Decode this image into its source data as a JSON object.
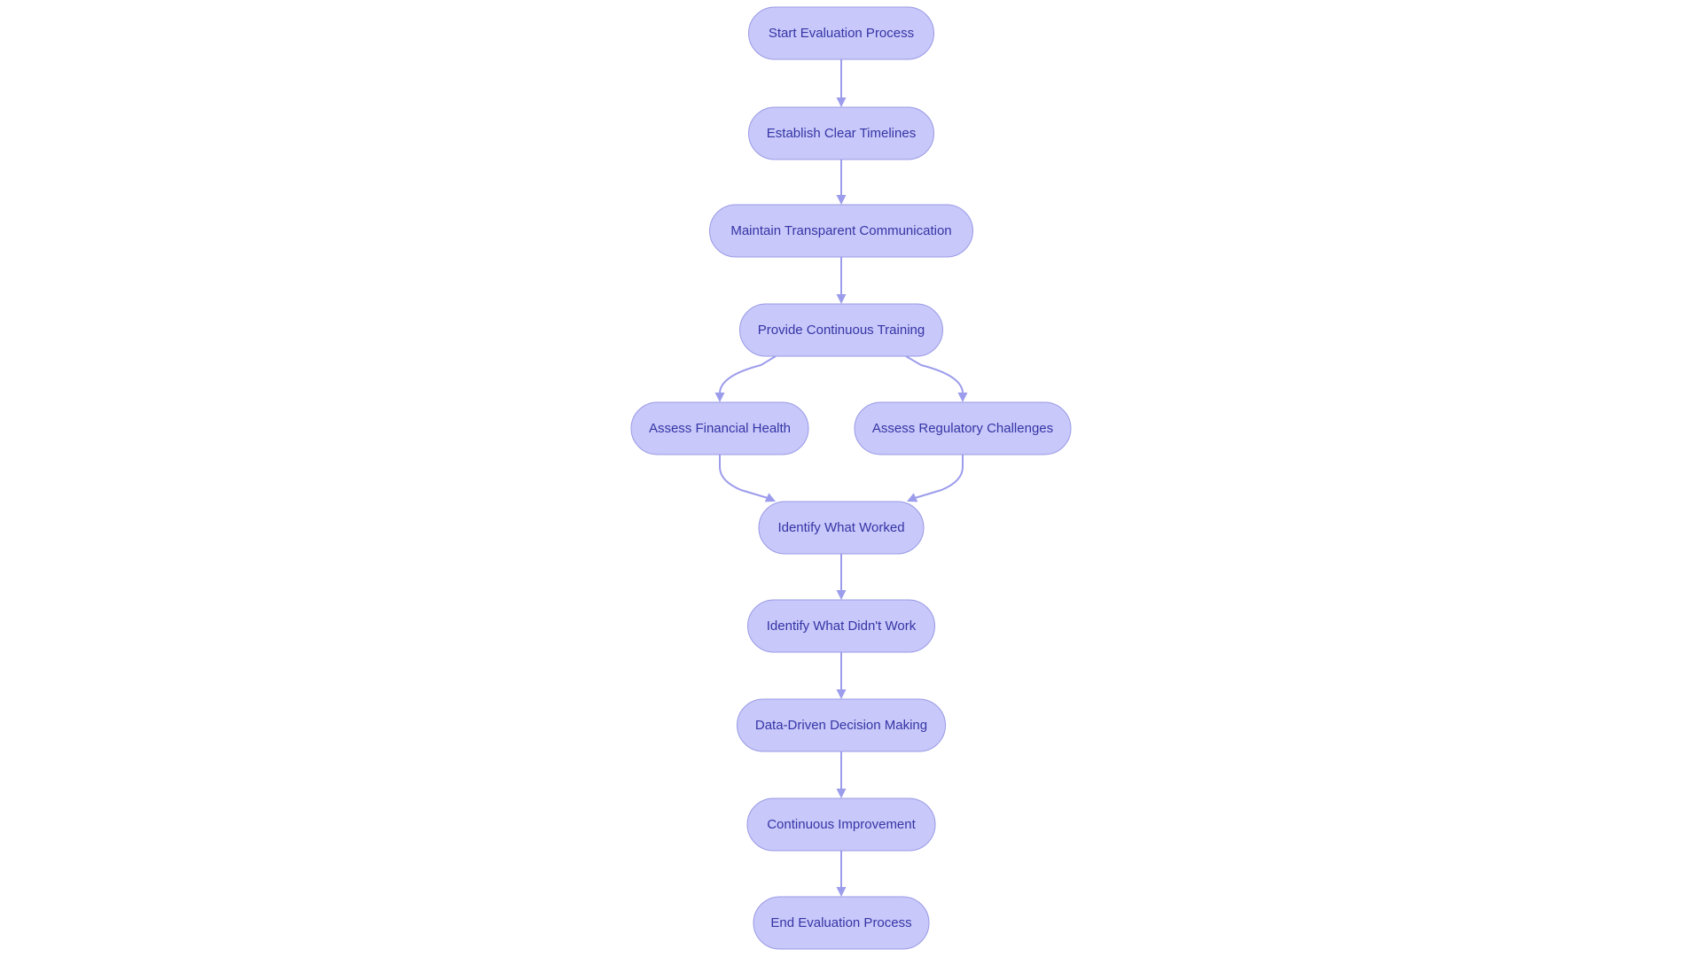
{
  "diagram": {
    "type": "flowchart",
    "direction": "top-to-bottom",
    "colors": {
      "node_fill": "#c8c8fa",
      "node_stroke": "#9a9ae6",
      "node_text": "#3535a6",
      "edge": "#9c9cec",
      "background": "#ffffff"
    },
    "nodes": [
      {
        "id": "start",
        "label": "Start Evaluation Process"
      },
      {
        "id": "timelines",
        "label": "Establish Clear Timelines"
      },
      {
        "id": "communication",
        "label": "Maintain Transparent Communication"
      },
      {
        "id": "training",
        "label": "Provide Continuous Training"
      },
      {
        "id": "financial",
        "label": "Assess Financial Health"
      },
      {
        "id": "regulatory",
        "label": "Assess Regulatory Challenges"
      },
      {
        "id": "worked",
        "label": "Identify What Worked"
      },
      {
        "id": "didnt_work",
        "label": "Identify What Didn't Work"
      },
      {
        "id": "decision",
        "label": "Data-Driven Decision Making"
      },
      {
        "id": "improvement",
        "label": "Continuous Improvement"
      },
      {
        "id": "end",
        "label": "End Evaluation Process"
      }
    ],
    "edges": [
      {
        "from": "start",
        "to": "timelines"
      },
      {
        "from": "timelines",
        "to": "communication"
      },
      {
        "from": "communication",
        "to": "training"
      },
      {
        "from": "training",
        "to": "financial"
      },
      {
        "from": "training",
        "to": "regulatory"
      },
      {
        "from": "financial",
        "to": "worked"
      },
      {
        "from": "regulatory",
        "to": "worked"
      },
      {
        "from": "worked",
        "to": "didnt_work"
      },
      {
        "from": "didnt_work",
        "to": "decision"
      },
      {
        "from": "decision",
        "to": "improvement"
      },
      {
        "from": "improvement",
        "to": "end"
      }
    ]
  }
}
